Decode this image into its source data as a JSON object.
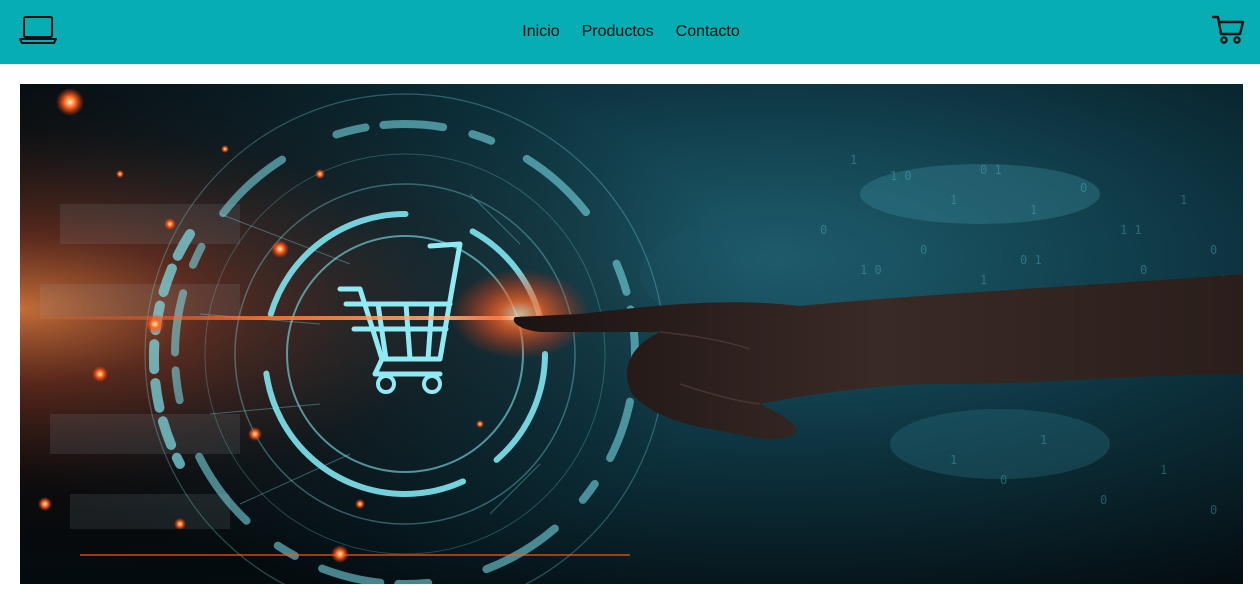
{
  "header": {
    "brand_icon": "laptop-icon",
    "cart_icon": "shopping-cart-icon",
    "background_color": "#06adb2",
    "nav": [
      {
        "label": "Inicio"
      },
      {
        "label": "Productos"
      },
      {
        "label": "Contacto"
      }
    ]
  },
  "hero": {
    "image_subject": "hand-touching-holographic-shopping-cart",
    "glow_color": "#7fe6f0",
    "spark_color": "#ff5a1a"
  }
}
